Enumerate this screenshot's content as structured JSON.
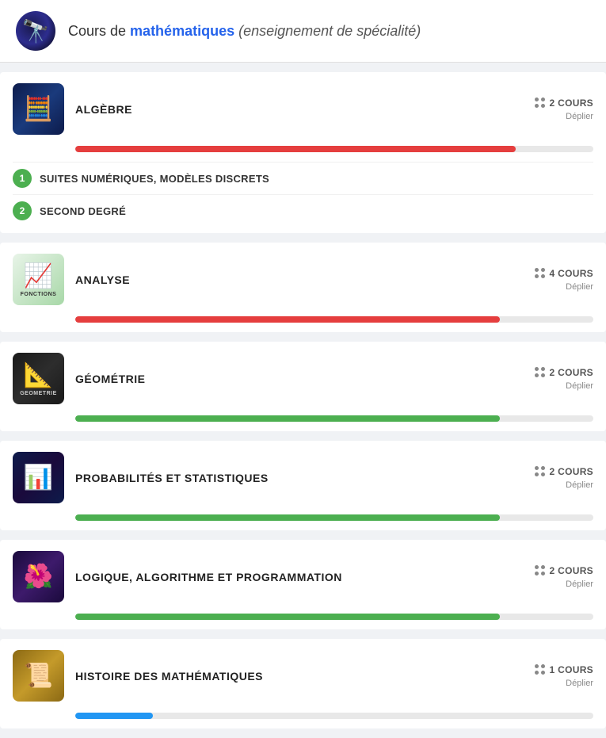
{
  "header": {
    "title_prefix": "Cours de ",
    "title_highlight": "mathématiques",
    "title_suffix": " (enseignement de spécialité)",
    "avatar_emoji": "🔭"
  },
  "sections": [
    {
      "id": "algebre",
      "title": "ALGÈBRE",
      "icon_emoji": "🧮",
      "icon_class": "icon-algebre",
      "cours_count": "2 COURS",
      "deplier": "Déplier",
      "progress": 85,
      "progress_color": "#e53e3e",
      "sub_items": [
        {
          "number": 1,
          "label": "SUITES NUMÉRIQUES, MODÈLES DISCRETS",
          "color": "#4caf50"
        },
        {
          "number": 2,
          "label": "SECOND DEGRÉ",
          "color": "#4caf50"
        }
      ]
    },
    {
      "id": "analyse",
      "title": "ANALYSE",
      "icon_emoji": "📈",
      "icon_class": "icon-analyse",
      "icon_label": "FONCTIONS",
      "cours_count": "4 COURS",
      "deplier": "Déplier",
      "progress": 82,
      "progress_color": "#e53e3e",
      "sub_items": []
    },
    {
      "id": "geometrie",
      "title": "GÉOMÉTRIE",
      "icon_emoji": "📐",
      "icon_class": "icon-geometrie",
      "icon_label": "GEOMETRIE",
      "cours_count": "2 COURS",
      "deplier": "Déplier",
      "progress": 82,
      "progress_color": "#4caf50",
      "sub_items": []
    },
    {
      "id": "proba",
      "title": "PROBABILITÉS ET STATISTIQUES",
      "icon_emoji": "📊",
      "icon_class": "icon-proba",
      "cours_count": "2 COURS",
      "deplier": "Déplier",
      "progress": 82,
      "progress_color": "#4caf50",
      "sub_items": []
    },
    {
      "id": "algo",
      "title": "LOGIQUE, ALGORITHME ET PROGRAMMATION",
      "icon_emoji": "🌺",
      "icon_class": "icon-algo",
      "cours_count": "2 COURS",
      "deplier": "Déplier",
      "progress": 82,
      "progress_color": "#4caf50",
      "sub_items": []
    },
    {
      "id": "histoire",
      "title": "HISTOIRE DES MATHÉMATIQUES",
      "icon_emoji": "📜",
      "icon_class": "icon-histoire",
      "cours_count": "1 COURS",
      "deplier": "Déplier",
      "progress": 15,
      "progress_color": "#2196f3",
      "sub_items": []
    }
  ]
}
